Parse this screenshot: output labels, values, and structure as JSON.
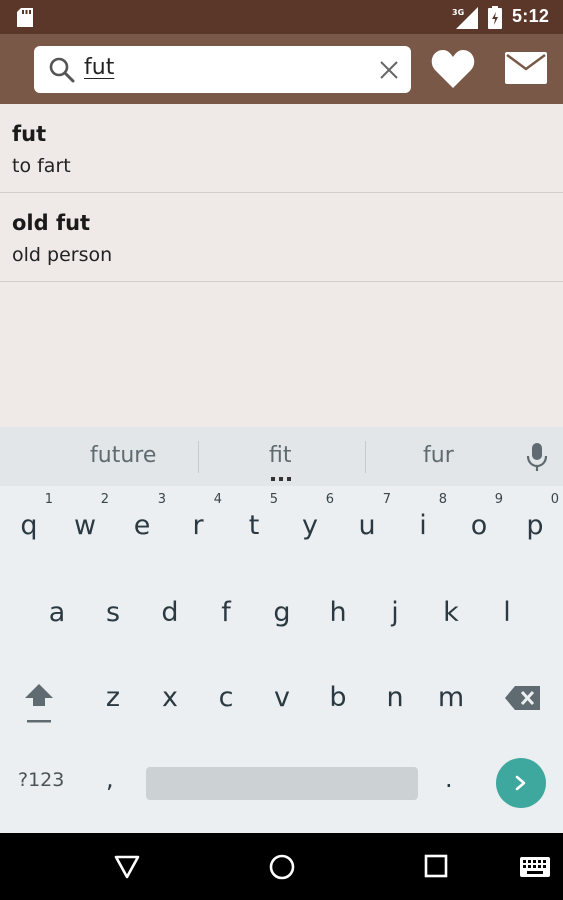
{
  "status_bar": {
    "time": "5:12",
    "network": "3G",
    "icons": [
      "sd-card-icon",
      "signal-icon",
      "battery-icon"
    ]
  },
  "app_bar": {
    "search": {
      "value": "fut"
    },
    "icons": [
      "search-icon",
      "clear-icon",
      "heart-icon",
      "mail-icon"
    ]
  },
  "results": [
    {
      "term": "fut",
      "definition": "to fart"
    },
    {
      "term": "old fut",
      "definition": "old person"
    }
  ],
  "keyboard": {
    "suggestions": [
      "future",
      "fit",
      "fur"
    ],
    "row1": [
      {
        "key": "q",
        "hint": "1"
      },
      {
        "key": "w",
        "hint": "2"
      },
      {
        "key": "e",
        "hint": "3"
      },
      {
        "key": "r",
        "hint": "4"
      },
      {
        "key": "t",
        "hint": "5"
      },
      {
        "key": "y",
        "hint": "6"
      },
      {
        "key": "u",
        "hint": "7"
      },
      {
        "key": "i",
        "hint": "8"
      },
      {
        "key": "o",
        "hint": "9"
      },
      {
        "key": "p",
        "hint": "0"
      }
    ],
    "row2": [
      "a",
      "s",
      "d",
      "f",
      "g",
      "h",
      "j",
      "k",
      "l"
    ],
    "row3": [
      "z",
      "x",
      "c",
      "v",
      "b",
      "n",
      "m"
    ],
    "symbols_label": "?123",
    "comma": ",",
    "period": "."
  },
  "colors": {
    "status_bar": "#5b3729",
    "app_bar": "#7a5847",
    "list_background": "#efe9e8",
    "keyboard_background": "#eceff1",
    "enter_key": "#3fa89e"
  },
  "nav_bar": {
    "icons": [
      "back-icon",
      "home-icon",
      "recents-icon",
      "keyboard-icon"
    ]
  }
}
